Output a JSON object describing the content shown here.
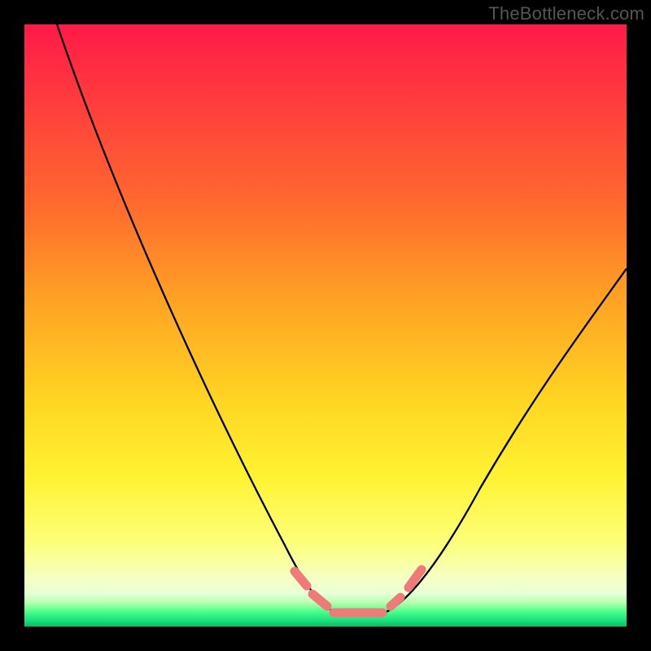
{
  "watermark": {
    "text": "TheBottleneck.com"
  },
  "chart_data": {
    "type": "line",
    "title": "",
    "xlabel": "",
    "ylabel": "",
    "xlim": [
      0,
      100
    ],
    "ylim": [
      0,
      100
    ],
    "grid": false,
    "legend": false,
    "background": "red-yellow-green vertical gradient",
    "series": [
      {
        "name": "left-curve",
        "x": [
          5,
          10,
          15,
          20,
          25,
          30,
          35,
          40,
          45,
          48,
          50,
          52
        ],
        "y": [
          102,
          86,
          71,
          57,
          44,
          33,
          23,
          14,
          7,
          4,
          2.5,
          2
        ]
      },
      {
        "name": "right-curve",
        "x": [
          58,
          60,
          63,
          68,
          74,
          81,
          88,
          95,
          100
        ],
        "y": [
          2,
          2.5,
          4,
          8,
          15,
          25,
          37,
          50,
          60
        ]
      },
      {
        "name": "highlight-segments",
        "color": "#f07070",
        "segments": [
          {
            "x": [
              44,
              47
            ],
            "y": [
              8,
              5
            ]
          },
          {
            "x": [
              47.5,
              49.5
            ],
            "y": [
              4.2,
              3
            ]
          },
          {
            "x": [
              50,
              58
            ],
            "y": [
              2,
              2
            ]
          },
          {
            "x": [
              59,
              61
            ],
            "y": [
              2.7,
              3.5
            ]
          },
          {
            "x": [
              62,
              64
            ],
            "y": [
              4.5,
              6.5
            ]
          }
        ]
      }
    ]
  }
}
